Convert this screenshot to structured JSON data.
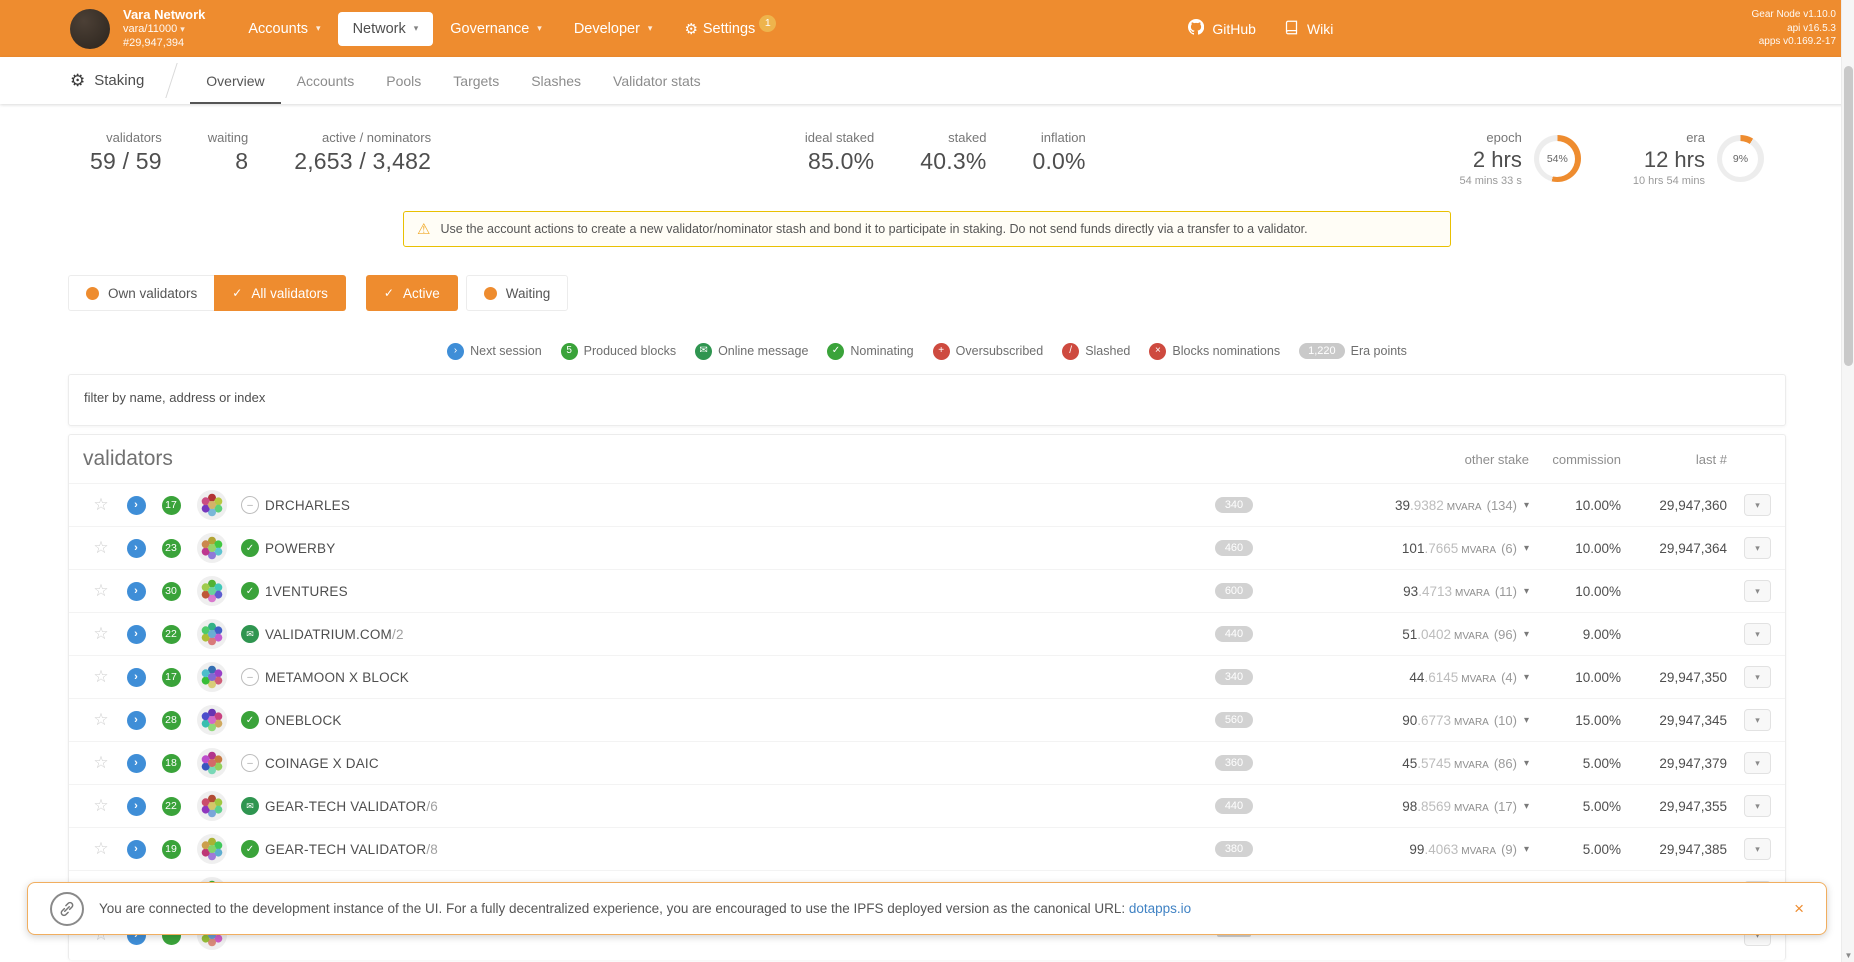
{
  "theme": {
    "orange": "#ee8c2f",
    "blue": "#3f8ed7",
    "green": "#3aa33a",
    "red": "#ce4a3f",
    "link": "#4183c4"
  },
  "header": {
    "network_name": "Vara Network",
    "chain_selector": "vara/11000",
    "best_block": "#29,947,394",
    "menu": [
      {
        "label": "Accounts"
      },
      {
        "label": "Network",
        "active": true
      },
      {
        "label": "Governance"
      },
      {
        "label": "Developer"
      },
      {
        "label": "Settings",
        "badge": "1"
      }
    ],
    "links": [
      {
        "label": "GitHub"
      },
      {
        "label": "Wiki"
      }
    ],
    "versions": [
      "Gear Node v1.10.0",
      "api v16.5.3",
      "apps v0.169.2-17"
    ]
  },
  "nav": {
    "section": "Staking",
    "tabs": [
      {
        "label": "Overview",
        "active": true
      },
      {
        "label": "Accounts"
      },
      {
        "label": "Pools"
      },
      {
        "label": "Targets"
      },
      {
        "label": "Slashes"
      },
      {
        "label": "Validator stats"
      }
    ]
  },
  "summary": {
    "validators": {
      "label": "validators",
      "value": "59 / 59"
    },
    "waiting": {
      "label": "waiting",
      "value": "8"
    },
    "active_nominators": {
      "label": "active / nominators",
      "value": "2,653 / 3,482"
    },
    "ideal_staked": {
      "label": "ideal staked",
      "value": "85.0%"
    },
    "staked": {
      "label": "staked",
      "value": "40.3%"
    },
    "inflation": {
      "label": "inflation",
      "value": "0.0%"
    },
    "epoch": {
      "label": "epoch",
      "value": "2 hrs",
      "sub": "54 mins 33 s",
      "percent": "54%",
      "fraction": 0.54
    },
    "era": {
      "label": "era",
      "value": "12 hrs",
      "sub": "10 hrs 54 mins",
      "percent": "9%",
      "fraction": 0.09
    }
  },
  "warning": "Use the account actions to create a new validator/nominator stash and bond it to participate in staking. Do not send funds directly via a transfer to a validator.",
  "filters": [
    {
      "label": "Own validators",
      "state": "off"
    },
    {
      "label": "All validators",
      "state": "on"
    },
    {
      "label": "Active",
      "state": "on"
    },
    {
      "label": "Waiting",
      "state": "off"
    }
  ],
  "legend": [
    {
      "label": "Next session",
      "type": "next"
    },
    {
      "label": "Produced blocks",
      "type": "blocks",
      "value": "5"
    },
    {
      "label": "Online message",
      "type": "message"
    },
    {
      "label": "Nominating",
      "type": "nominating"
    },
    {
      "label": "Oversubscribed",
      "type": "oversubscribed"
    },
    {
      "label": "Slashed",
      "type": "slashed"
    },
    {
      "label": "Blocks nominations",
      "type": "blocks-nominations"
    },
    {
      "label": "Era points",
      "type": "era-points",
      "value": "1,220"
    }
  ],
  "filter_input": {
    "placeholder": "filter by name, address or index"
  },
  "table": {
    "title": "validators",
    "headers": {
      "other_stake": "other stake",
      "commission": "commission",
      "last_block": "last #"
    },
    "rows": [
      {
        "blocks": "17",
        "name": "DRCHARLES",
        "sub": "",
        "status": "minus",
        "points": "340",
        "stake_int": "39",
        "stake_dec": ".9382",
        "stake_unit": "MVARA",
        "nominators": "(134)",
        "commission": "10.00%",
        "last_block": "29,947,360"
      },
      {
        "blocks": "23",
        "name": "POWERBY",
        "sub": "",
        "status": "check",
        "points": "460",
        "stake_int": "101",
        "stake_dec": ".7665",
        "stake_unit": "MVARA",
        "nominators": "(6)",
        "commission": "10.00%",
        "last_block": "29,947,364"
      },
      {
        "blocks": "30",
        "name": "1VENTURES",
        "sub": "",
        "status": "check",
        "points": "600",
        "stake_int": "93",
        "stake_dec": ".4713",
        "stake_unit": "MVARA",
        "nominators": "(11)",
        "commission": "10.00%",
        "last_block": ""
      },
      {
        "blocks": "22",
        "name": "VALIDATRIUM.COM",
        "sub": "/2",
        "status": "message",
        "points": "440",
        "stake_int": "51",
        "stake_dec": ".0402",
        "stake_unit": "MVARA",
        "nominators": "(96)",
        "commission": "9.00%",
        "last_block": ""
      },
      {
        "blocks": "17",
        "name": "METAMOON X BLOCK",
        "sub": "",
        "status": "minus",
        "points": "340",
        "stake_int": "44",
        "stake_dec": ".6145",
        "stake_unit": "MVARA",
        "nominators": "(4)",
        "commission": "10.00%",
        "last_block": "29,947,350"
      },
      {
        "blocks": "28",
        "name": "ONEBLOCK",
        "sub": "",
        "status": "check",
        "points": "560",
        "stake_int": "90",
        "stake_dec": ".6773",
        "stake_unit": "MVARA",
        "nominators": "(10)",
        "commission": "15.00%",
        "last_block": "29,947,345"
      },
      {
        "blocks": "18",
        "name": "COINAGE X DAIC",
        "sub": "",
        "status": "minus",
        "points": "360",
        "stake_int": "45",
        "stake_dec": ".5745",
        "stake_unit": "MVARA",
        "nominators": "(86)",
        "commission": "5.00%",
        "last_block": "29,947,379"
      },
      {
        "blocks": "22",
        "name": "GEAR-TECH VALIDATOR",
        "sub": "/6",
        "status": "message",
        "points": "440",
        "stake_int": "98",
        "stake_dec": ".8569",
        "stake_unit": "MVARA",
        "nominators": "(17)",
        "commission": "5.00%",
        "last_block": "29,947,355"
      },
      {
        "blocks": "19",
        "name": "GEAR-TECH VALIDATOR",
        "sub": "/8",
        "status": "check",
        "points": "380",
        "stake_int": "99",
        "stake_dec": ".4063",
        "stake_unit": "MVARA",
        "nominators": "(9)",
        "commission": "5.00%",
        "last_block": "29,947,385"
      },
      {
        "blocks": "",
        "name": "",
        "sub": "",
        "status": "",
        "points": "",
        "stake_int": "",
        "stake_dec": "",
        "stake_unit": "",
        "nominators": "",
        "commission": "",
        "last_block": ""
      },
      {
        "blocks": "",
        "name": "",
        "sub": "",
        "status": "",
        "points": "",
        "stake_int": "",
        "stake_dec": "",
        "stake_unit": "",
        "nominators": "",
        "commission": "",
        "last_block": ""
      }
    ]
  },
  "banner": {
    "text": "You are connected to the development instance of the UI. For a fully decentralized experience, you are encouraged to use the IPFS deployed version as the canonical URL: ",
    "link": "dotapps.io"
  }
}
